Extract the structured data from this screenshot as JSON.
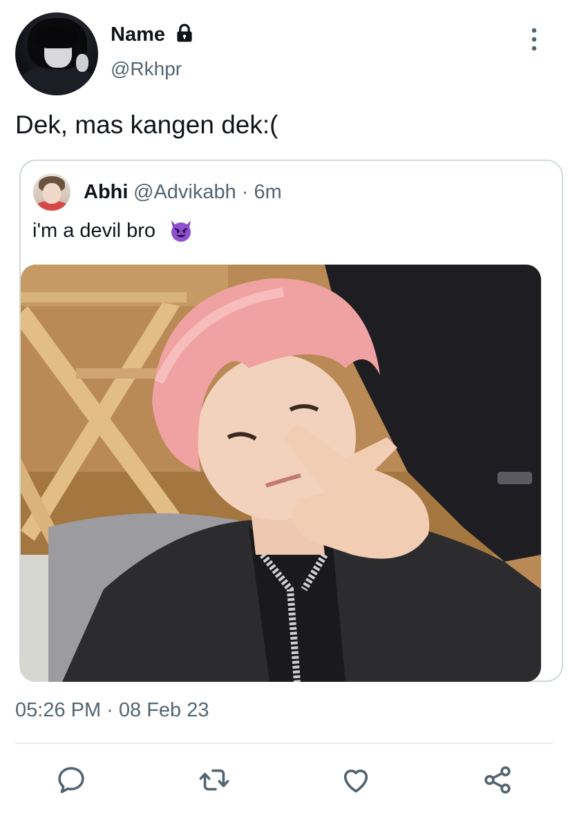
{
  "author": {
    "name": "Name",
    "handle": "@Rkhpr"
  },
  "tweet": {
    "text": "Dek, mas kangen dek:("
  },
  "quoted_tweet": {
    "name": "Abhi",
    "handle_time": "@Advikabh · 6m",
    "text": "i'm a devil bro",
    "emoji": "smiling-face-with-horns"
  },
  "meta": {
    "timestamp": "05:26 PM · 08 Feb 23"
  },
  "actions": [
    "reply-icon",
    "retweet-icon",
    "like-icon",
    "share-icon"
  ],
  "colors": {
    "text_primary": "#0f1419",
    "text_secondary": "#536471",
    "border": "#cfd9de",
    "icon": "#536471",
    "devil": "#7d3fbf"
  }
}
